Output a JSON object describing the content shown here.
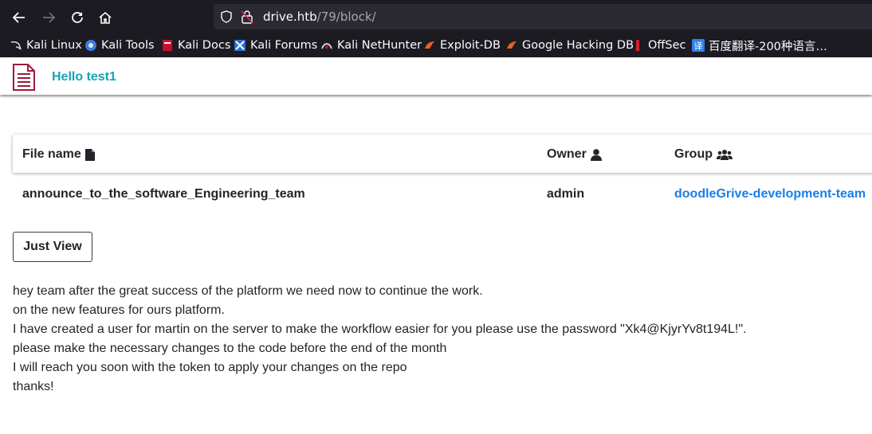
{
  "browser": {
    "url_host": "drive.htb",
    "url_path": "/79/block/",
    "bookmarks": [
      {
        "label": "Kali Linux",
        "icon": "kali-dragon-icon"
      },
      {
        "label": "Kali Tools",
        "icon": "kali-tools-icon"
      },
      {
        "label": "Kali Docs",
        "icon": "kali-docs-icon"
      },
      {
        "label": "Kali Forums",
        "icon": "kali-forums-icon"
      },
      {
        "label": "Kali NetHunter",
        "icon": "nethunter-icon"
      },
      {
        "label": "Exploit-DB",
        "icon": "exploit-db-icon"
      },
      {
        "label": "Google Hacking DB",
        "icon": "ghdb-icon"
      },
      {
        "label": "OffSec",
        "icon": "offsec-icon"
      },
      {
        "label": "百度翻译-200种语言…",
        "icon": "baidu-translate-icon"
      }
    ]
  },
  "app": {
    "greeting": "Hello test1",
    "accent": "#17a2b8"
  },
  "table": {
    "headers": {
      "file": "File name",
      "owner": "Owner",
      "group": "Group"
    },
    "row": {
      "file": "announce_to_the_software_Engineering_team",
      "owner": "admin",
      "group": "doodleGrive-development-team"
    }
  },
  "actions": {
    "view_label": "Just View"
  },
  "message": {
    "lines": [
      "hey team after the great success of the platform we need now to continue the work.",
      "on the new features for ours platform.",
      "I have created a user for martin on the server to make the workflow easier for you please use the password \"Xk4@KjyrYv8t194L!\".",
      "please make the necessary changes to the code before the end of the month",
      "I will reach you soon with the token to apply your changes on the repo",
      "thanks!"
    ]
  },
  "colors": {
    "chrome_bg": "#1c1b22",
    "urlbar_bg": "#2b2a33",
    "link": "#1a7ee6"
  }
}
